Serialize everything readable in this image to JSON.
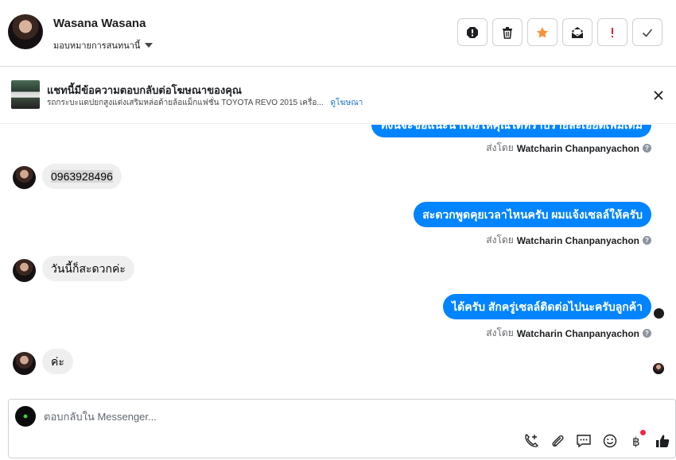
{
  "header": {
    "contact_name": "Wasana Wasana",
    "assign_label": "มอบหมายการสนทนานี้",
    "actions": [
      {
        "name": "spam-icon",
        "glyph": "!"
      },
      {
        "name": "trash-icon",
        "glyph": ""
      },
      {
        "name": "star-icon",
        "glyph": ""
      },
      {
        "name": "mark-unread-icon",
        "glyph": ""
      },
      {
        "name": "follow-up-icon",
        "glyph": "!"
      },
      {
        "name": "done-check-icon",
        "glyph": ""
      }
    ]
  },
  "banner": {
    "title": "แชทนี้มีข้อความตอบกลับต่อโฆษณาของคุณ",
    "subtitle": "รถกระบะแดปยกสูงแต่งเสริมหล่อด้ายล้อแม็กแฟชั่น TOYOTA REVO 2015 เครื่อ...",
    "link": "ดูโฆษณา"
  },
  "thread": {
    "messages": [
      {
        "side": "out",
        "text": "ทั้งนี้จะขอแนะนำเพื่อให้คุณได้ทราบรายละเอียดเพิ่มเติม",
        "sent_by_label": "ส่งโดย",
        "sender": "Watcharin Chanpanyachon"
      },
      {
        "side": "in",
        "text": "0963928496"
      },
      {
        "side": "out",
        "text": "สะดวกพูดคุยเวลาไหนครับ ผมแจ้งเซลล์ให้ครับ",
        "sent_by_label": "ส่งโดย",
        "sender": "Watcharin Chanpanyachon"
      },
      {
        "side": "in",
        "text": "วันนี้ก็สะดวกค่ะ"
      },
      {
        "side": "out",
        "text": "ได้ครับ สักครู่เซลล์ติดต่อไปนะครับลูกค้า",
        "sent_by_label": "ส่งโดย",
        "sender": "Watcharin Chanpanyachon"
      },
      {
        "side": "in",
        "text": "ค่ะ"
      }
    ]
  },
  "composer": {
    "placeholder": "ตอบกลับใน Messenger...",
    "tools": [
      "call-add-icon",
      "attachment-icon",
      "saved-reply-icon",
      "emoji-icon",
      "payment-icon",
      "like-icon"
    ]
  },
  "colors": {
    "accent": "#0084ff",
    "incoming_bubble": "#efefef",
    "star": "#f7923a",
    "follow_up": "#e41e3f"
  }
}
